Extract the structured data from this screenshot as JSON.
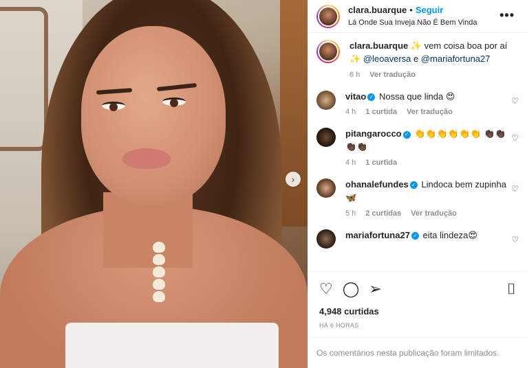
{
  "header": {
    "username": "clara.buarque",
    "separator": "•",
    "follow_label": "Seguir",
    "subtitle": "Lá Onde Sua Inveja Não É Bem Vinda",
    "more_icon": "more-horizontal-icon",
    "more_glyph": "•••"
  },
  "caption": {
    "username": "clara.buarque",
    "text_pre": " ✨ vem coisa boa por aí ✨ ",
    "mention1": "@leoaversa",
    "text_mid": " e ",
    "mention2": "@mariafortuna27",
    "time": "6 h",
    "translate": "Ver tradução"
  },
  "comments": [
    {
      "username": "vitao",
      "verified": true,
      "text": "Nossa que linda 😍",
      "time": "4 h",
      "likes": "1 curtida",
      "translate": "Ver tradução"
    },
    {
      "username": "pitangarocco",
      "verified": true,
      "text": "👏👏👏👏👏👏 👏🏿👏🏿👏🏿👏🏿",
      "time": "4 h",
      "likes": "1 curtida",
      "translate": ""
    },
    {
      "username": "ohanalefundes",
      "verified": true,
      "text": "Lindoca bem zupinha 🦋",
      "time": "5 h",
      "likes": "2 curtidas",
      "translate": "Ver tradução"
    },
    {
      "username": "mariafortuna27",
      "verified": true,
      "text": "eita lindeza😍",
      "time": "",
      "likes": "",
      "translate": ""
    }
  ],
  "actions": {
    "like_icon": "heart-icon",
    "comment_icon": "comment-icon",
    "share_icon": "share-icon",
    "save_icon": "bookmark-icon",
    "like_glyph": "♡",
    "comment_glyph": "◯",
    "share_glyph": "➢",
    "save_glyph": "⌷",
    "likes_count": "4,948 curtidas",
    "posted": "HÁ 6 HORAS"
  },
  "comment_heart_glyph": "♡",
  "next_glyph": "›",
  "verified_glyph": "✓",
  "footer": {
    "limited_text": "Os comentários nesta publicação foram limitados."
  }
}
